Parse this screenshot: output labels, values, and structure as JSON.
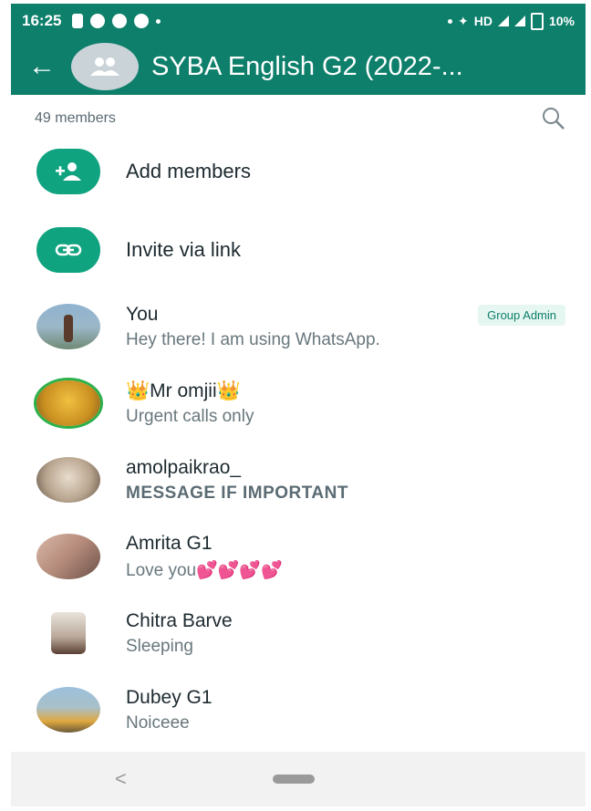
{
  "status_bar": {
    "time": "16:25",
    "right_text": "HD",
    "battery": "10%"
  },
  "app_bar": {
    "title": "SYBA English G2 (2022-..."
  },
  "members_header": {
    "count_label": "49 members"
  },
  "actions": [
    {
      "label": "Add members",
      "icon": "add-member-icon"
    },
    {
      "label": "Invite via link",
      "icon": "link-icon"
    }
  ],
  "members": [
    {
      "name": "You",
      "status": "Hey there! I am using WhatsApp.",
      "badge": "Group Admin"
    },
    {
      "name": "👑Mr omjii👑",
      "status": "Urgent calls only"
    },
    {
      "name": "amolpaikrao_",
      "status": "MESSAGE IF IMPORTANT"
    },
    {
      "name": "Amrita G1",
      "status": "Love you💕💕💕💕"
    },
    {
      "name": "Chitra Barve",
      "status": "Sleeping"
    },
    {
      "name": "Dubey G1",
      "status": "Noiceee"
    }
  ],
  "colors": {
    "header_green": "#0d7f6b",
    "action_green": "#10a37f",
    "badge_bg": "#e6f6f1"
  }
}
